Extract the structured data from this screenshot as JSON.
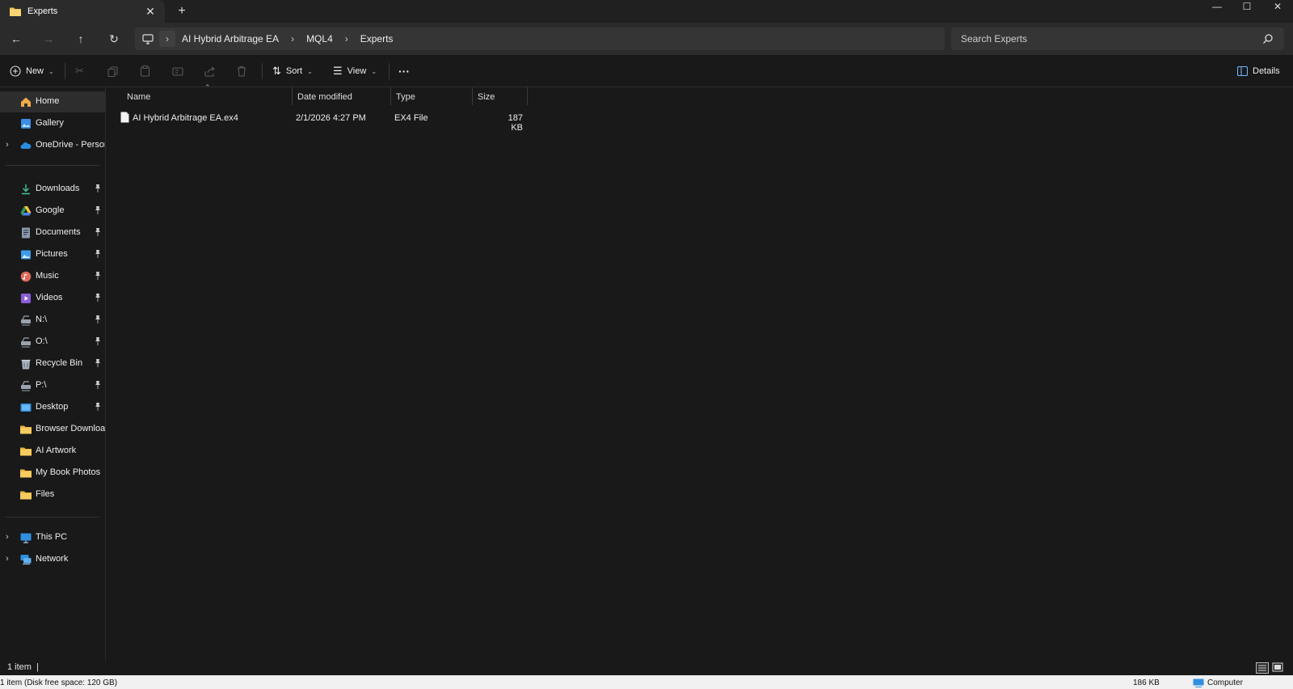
{
  "window": {
    "tab_title": "Experts",
    "tab_close": "✕",
    "new_tab": "+",
    "minimize": "—",
    "maximize": "☐",
    "close": "✕"
  },
  "navigation": {
    "back": "←",
    "forward": "→",
    "up": "↑",
    "refresh": "↻",
    "breadcrumb": [
      "AI Hybrid Arbitrage EA",
      "MQL4",
      "Experts"
    ],
    "search_placeholder": "Search Experts"
  },
  "command_bar": {
    "new_label": "New",
    "sort_label": "Sort",
    "view_label": "View",
    "more_label": "···",
    "details_label": "Details"
  },
  "sidebar": {
    "top": [
      {
        "label": "Home",
        "icon": "home-icon",
        "selected": true
      },
      {
        "label": "Gallery",
        "icon": "gallery-icon"
      },
      {
        "label": "OneDrive - Persona",
        "icon": "onedrive-icon",
        "expandable": true
      }
    ],
    "quick_access": [
      {
        "label": "Downloads",
        "icon": "download-icon",
        "pinned": true
      },
      {
        "label": "Google",
        "icon": "google-drive-icon",
        "pinned": true
      },
      {
        "label": "Documents",
        "icon": "documents-icon",
        "pinned": true
      },
      {
        "label": "Pictures",
        "icon": "pictures-icon",
        "pinned": true
      },
      {
        "label": "Music",
        "icon": "music-icon",
        "pinned": true
      },
      {
        "label": "Videos",
        "icon": "videos-icon",
        "pinned": true
      },
      {
        "label": "N:\\",
        "icon": "network-drive-icon",
        "pinned": true
      },
      {
        "label": "O:\\",
        "icon": "network-drive-icon",
        "pinned": true
      },
      {
        "label": "Recycle Bin",
        "icon": "recycle-bin-icon",
        "pinned": true
      },
      {
        "label": "P:\\",
        "icon": "network-drive-icon",
        "pinned": true
      },
      {
        "label": "Desktop",
        "icon": "desktop-icon",
        "pinned": true
      },
      {
        "label": "Browser Downloads",
        "icon": "folder-icon"
      },
      {
        "label": "AI Artwork",
        "icon": "folder-icon"
      },
      {
        "label": "My Book Photos",
        "icon": "folder-icon"
      },
      {
        "label": "Files",
        "icon": "folder-icon"
      }
    ],
    "bottom": [
      {
        "label": "This PC",
        "icon": "this-pc-icon",
        "expandable": true
      },
      {
        "label": "Network",
        "icon": "network-icon",
        "expandable": true
      }
    ]
  },
  "columns": {
    "name": "Name",
    "date_modified": "Date modified",
    "type": "Type",
    "size": "Size"
  },
  "files": [
    {
      "name": "AI Hybrid Arbitrage EA.ex4",
      "date_modified": "2/1/2026 4:27 PM",
      "type": "EX4 File",
      "size": "187 KB"
    }
  ],
  "status": {
    "item_count": "1 item",
    "separator": "|",
    "disk_info": "1 item (Disk free space: 120 GB)",
    "size": "186 KB",
    "location": "Computer"
  },
  "colors": {
    "accent_folder": "#f2c45a",
    "background": "#191919",
    "chrome": "#2b2b2b"
  }
}
